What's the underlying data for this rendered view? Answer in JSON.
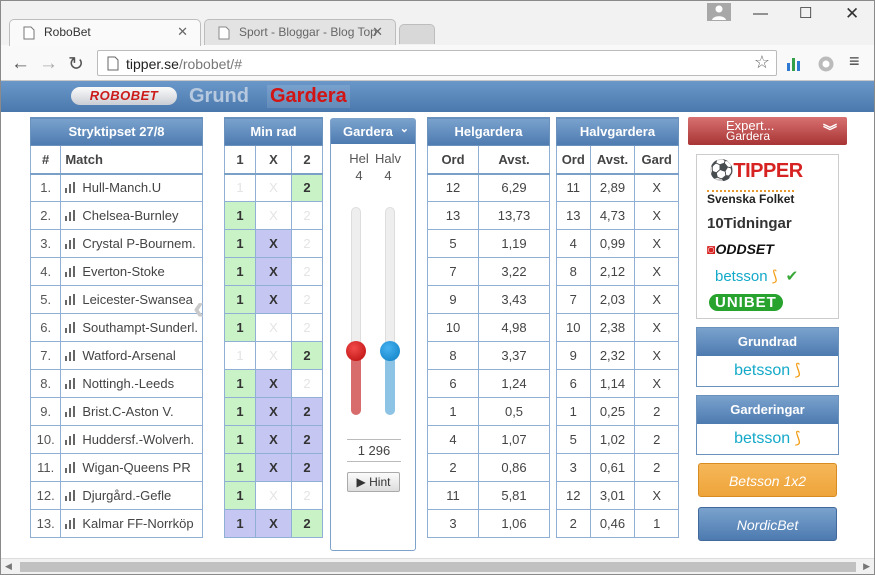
{
  "browser": {
    "tabs": [
      {
        "title": "RoboBet",
        "close": "✕"
      },
      {
        "title": "Sport - Bloggar - Blog Top",
        "close": "✕"
      }
    ],
    "url_host": "tipper.se",
    "url_path": "/robobet/#"
  },
  "site": {
    "logo": "ROBOBET",
    "nav_grund": "Grund",
    "nav_gardera": "Gardera"
  },
  "stryktips": {
    "title": "Stryktipset 27/8",
    "col_num": "#",
    "col_match": "Match",
    "matches": [
      "Hull-Manch.U",
      "Chelsea-Burnley",
      "Crystal P-Bournem.",
      "Everton-Stoke",
      "Leicester-Swansea",
      "Southampt-Sunderl.",
      "Watford-Arsenal",
      "Nottingh.-Leeds",
      "Brist.C-Aston V.",
      "Huddersf.-Wolverh.",
      "Wigan-Queens PR",
      "Djurgård.-Gefle",
      "Kalmar FF-Norrköp"
    ]
  },
  "minrad": {
    "title": "Min rad",
    "cols": [
      "1",
      "X",
      "2"
    ],
    "rows": [
      [
        "e1",
        "eX",
        "g2"
      ],
      [
        "g1",
        "eX",
        "e2"
      ],
      [
        "g1",
        "pX",
        "e2"
      ],
      [
        "g1",
        "pX",
        "e2"
      ],
      [
        "g1",
        "pX",
        "e2"
      ],
      [
        "g1",
        "eX",
        "e2"
      ],
      [
        "e1",
        "eX",
        "g2"
      ],
      [
        "g1",
        "pX",
        "e2"
      ],
      [
        "g1",
        "pX",
        "p2"
      ],
      [
        "g1",
        "pX",
        "p2"
      ],
      [
        "g1",
        "pX",
        "p2"
      ],
      [
        "g1",
        "eX",
        "e2"
      ],
      [
        "p1",
        "pX",
        "g2"
      ]
    ]
  },
  "gardera": {
    "title": "Gardera",
    "hel_label": "Hel",
    "halv_label": "Halv",
    "hel_value": "4",
    "halv_value": "4",
    "count": "1 296",
    "hint": "Hint"
  },
  "helgardera": {
    "title": "Helgardera",
    "col_ord": "Ord",
    "col_avst": "Avst.",
    "ord": [
      "12",
      "13",
      "5",
      "7",
      "9",
      "10",
      "8",
      "6",
      "1",
      "4",
      "2",
      "11",
      "3"
    ],
    "avst": [
      "6,29",
      "13,73",
      "1,19",
      "3,22",
      "3,43",
      "4,98",
      "3,37",
      "1,24",
      "0,5",
      "1,07",
      "0,86",
      "5,81",
      "1,06"
    ]
  },
  "halvgardera": {
    "title": "Halvgardera",
    "col_ord": "Ord",
    "col_avst": "Avst.",
    "col_gard": "Gard",
    "ord": [
      "11",
      "13",
      "4",
      "8",
      "7",
      "10",
      "9",
      "6",
      "1",
      "5",
      "3",
      "12",
      "2"
    ],
    "avst": [
      "2,89",
      "4,73",
      "0,99",
      "2,12",
      "2,03",
      "2,38",
      "2,32",
      "1,14",
      "0,25",
      "1,02",
      "0,61",
      "3,01",
      "0,46"
    ],
    "gard": [
      "X",
      "X",
      "X",
      "X",
      "X",
      "X",
      "X",
      "X",
      "2",
      "2",
      "2",
      "X",
      "1"
    ]
  },
  "sidebar": {
    "expert_line1": "Expert...",
    "expert_line2": "Gardera",
    "brands": [
      "TIPPER",
      "Svenska Folket",
      "10Tidningar",
      "ODDSET",
      "betsson",
      "UNIBET"
    ],
    "grundrad": "Grundrad",
    "garderingar": "Garderingar",
    "betsson": "betsson",
    "betsson_1x2": "Betsson 1x2",
    "nordicbet": "NordicBet"
  },
  "colors": {
    "green": "#c9f3c6",
    "purple": "#c6c6f3",
    "header_blue": "#5a86b8",
    "red": "#d21414"
  }
}
